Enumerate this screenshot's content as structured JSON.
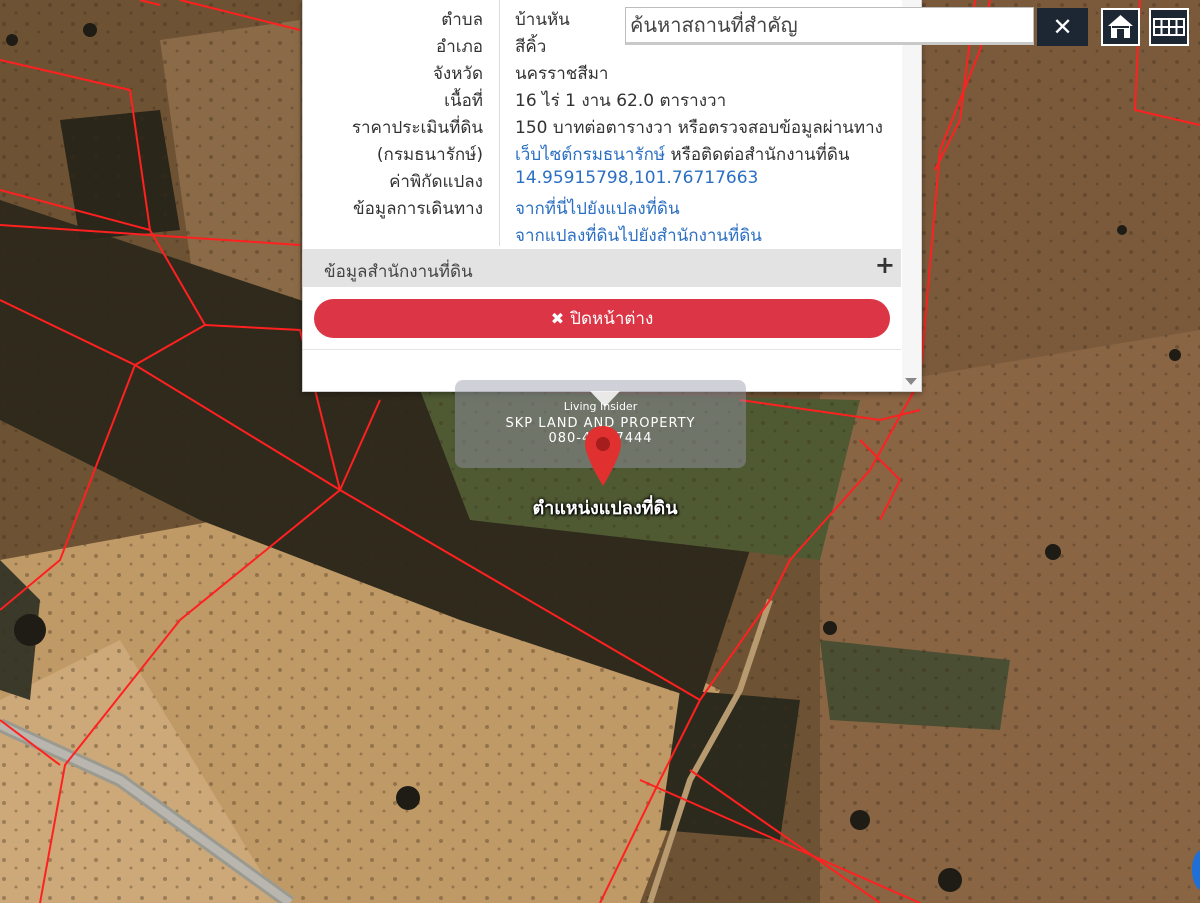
{
  "popup": {
    "rows": [
      {
        "label": "ตำบล",
        "value": "บ้านหัน"
      },
      {
        "label": "อำเภอ",
        "value": "สีคิ้ว"
      },
      {
        "label": "จังหวัด",
        "value": "นครราชสีมา"
      },
      {
        "label": "เนื้อที่",
        "value": "16 ไร่ 1 งาน 62.0 ตารางวา"
      },
      {
        "label": "ราคาประเมินที่ดิน",
        "value": "150 บาทต่อตารางวา หรือตรวจสอบข้อมูลผ่านทาง"
      },
      {
        "label": "(กรมธนารักษ์)",
        "value_link": "เว็บไซต์กรมธนารักษ์",
        "value_rest": " หรือติดต่อสำนักงานที่ดิน"
      },
      {
        "label": "ค่าพิกัดแปลง",
        "value_link": "14.95915798,101.76717663"
      },
      {
        "label": "ข้อมูลการเดินทาง",
        "value_link": "จากที่นี่ไปยังแปลงที่ดิน"
      },
      {
        "label": "",
        "value_link": "จากแปลงที่ดินไปยังสำนักงานที่ดิน"
      }
    ],
    "section_title": "ข้อมูลสำนักงานที่ดิน",
    "section_toggle": "+",
    "close_label": "ปิดหน้าต่าง",
    "close_icon": "✖"
  },
  "search": {
    "placeholder": "ค้นหาสถานที่สำคัญ",
    "clear_label": "✕"
  },
  "watermark": {
    "brand": "Living Insider",
    "company": "SKP LAND AND PROPERTY",
    "phone": "080-409-7444"
  },
  "marker": {
    "label": "ตำแหน่งแปลงที่ดิน"
  },
  "colors": {
    "boundary": "#ff2222",
    "button": "#dc3545",
    "marker": "#e0302f",
    "link": "#2a6fc4",
    "toolbar": "#1d2733"
  }
}
